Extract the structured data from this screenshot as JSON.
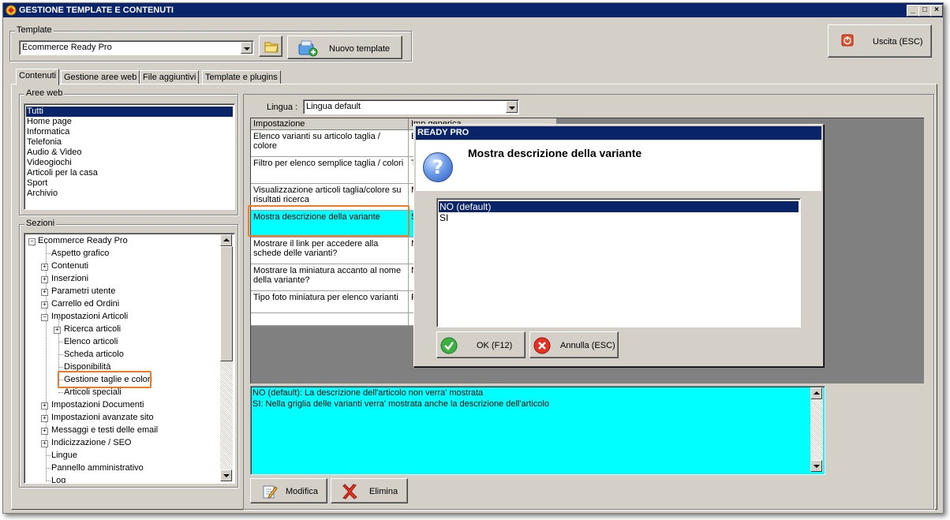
{
  "window": {
    "title": "GESTIONE TEMPLATE E CONTENUTI",
    "controls": [
      "_",
      "□",
      "×"
    ]
  },
  "template": {
    "group_label": "Template",
    "selected": "Ecommerce Ready Pro",
    "new_button": "Nuovo template",
    "exit_button": "Uscita (ESC)"
  },
  "tabs": [
    {
      "label": "Contenuti",
      "active": true
    },
    {
      "label": "Gestione aree web",
      "active": false
    },
    {
      "label": "File aggiuntivi",
      "active": false
    },
    {
      "label": "Template e plugins",
      "active": false
    }
  ],
  "aree_web": {
    "label": "Aree web",
    "items": [
      "Tutti",
      "Home page",
      "Informatica",
      "Telefonia",
      "Audio & Video",
      "Videogiochi",
      "Articoli per la casa",
      "Sport",
      "Archivio"
    ],
    "selected_index": 0
  },
  "sezioni": {
    "label": "Sezioni",
    "tree": [
      {
        "label": "Ecommerce Ready Pro",
        "level": 0,
        "expander": "minus"
      },
      {
        "label": "Aspetto grafico",
        "level": 1,
        "expander": "none"
      },
      {
        "label": "Contenuti",
        "level": 1,
        "expander": "plus"
      },
      {
        "label": "Inserzioni",
        "level": 1,
        "expander": "plus"
      },
      {
        "label": "Parametri utente",
        "level": 1,
        "expander": "plus"
      },
      {
        "label": "Carrello ed Ordini",
        "level": 1,
        "expander": "plus"
      },
      {
        "label": "Impostazioni Articoli",
        "level": 1,
        "expander": "minus"
      },
      {
        "label": "Ricerca articoli",
        "level": 2,
        "expander": "plus"
      },
      {
        "label": "Elenco articoli",
        "level": 2,
        "expander": "none"
      },
      {
        "label": "Scheda articolo",
        "level": 2,
        "expander": "none"
      },
      {
        "label": "Disponibilità",
        "level": 2,
        "expander": "none"
      },
      {
        "label": "Gestione taglie e colori",
        "level": 2,
        "expander": "none",
        "highlighted": true
      },
      {
        "label": "Articoli speciali",
        "level": 2,
        "expander": "none"
      },
      {
        "label": "Impostazioni Documenti",
        "level": 1,
        "expander": "plus"
      },
      {
        "label": "Impostazioni avanzate sito",
        "level": 1,
        "expander": "plus"
      },
      {
        "label": "Messaggi e testi delle email",
        "level": 1,
        "expander": "plus"
      },
      {
        "label": "Indicizzazione / SEO",
        "level": 1,
        "expander": "plus"
      },
      {
        "label": "Lingue",
        "level": 1,
        "expander": "none"
      },
      {
        "label": "Pannello amministrativo",
        "level": 1,
        "expander": "none"
      },
      {
        "label": "Log",
        "level": 1,
        "expander": "none"
      }
    ]
  },
  "lingua": {
    "label": "Lingua :",
    "selected": "Lingua default"
  },
  "settings_grid": {
    "headers": [
      "Impostazione",
      "Imp.generica"
    ],
    "rows": [
      {
        "setting": "Elenco varianti su articolo taglia / colore",
        "value": "E d"
      },
      {
        "setting": "Filtro per elenco semplice taglia / colori",
        "value": "T"
      },
      {
        "setting": "Visualizzazione articoli taglia/colore su risultati ricerca",
        "value": "M"
      },
      {
        "setting": "Mostra descrizione della variante",
        "value": "S",
        "selected": true
      },
      {
        "setting": "Mostrare il link per accedere alla schede delle varianti?",
        "value": "N"
      },
      {
        "setting": "Mostrare la miniatura accanto al nome della variante?",
        "value": "N"
      },
      {
        "setting": "Tipo foto miniatura per elenco varianti",
        "value": "F"
      },
      {
        "setting": "",
        "value": ""
      }
    ]
  },
  "description_memo": {
    "lines": [
      "NO (default): La descrizione dell'articolo non verra' mostrata",
      "SI: Nella griglia delle varianti verra' mostrata anche la descrizione dell'articolo"
    ]
  },
  "bottom_buttons": {
    "modifica": "Modifica",
    "elimina": "Elimina"
  },
  "dialog": {
    "title": "READY PRO",
    "question": "Mostra descrizione della variante",
    "options": [
      "NO (default)",
      "SI"
    ],
    "selected_index": 0,
    "ok_button": "OK (F12)",
    "cancel_button": "Annulla (ESC)"
  },
  "colors": {
    "titlebar": "#0a246a",
    "face": "#d4d0c8",
    "selection": "#0a246a",
    "highlight_cyan": "#00ffff",
    "annotation_orange": "#f07a28"
  }
}
